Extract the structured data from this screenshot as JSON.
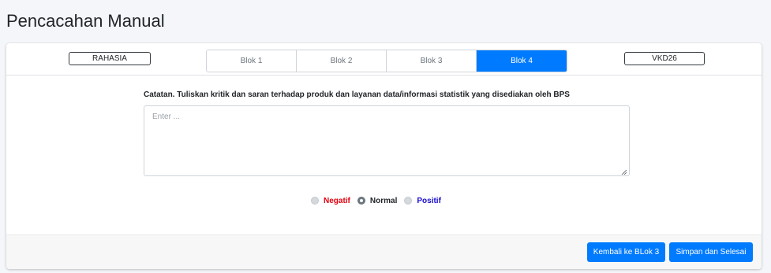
{
  "page": {
    "title": "Pencacahan Manual"
  },
  "header": {
    "left_badge": "RAHASIA",
    "right_badge": "VKD26",
    "tabs": [
      {
        "label": "Blok 1",
        "active": false
      },
      {
        "label": "Blok 2",
        "active": false
      },
      {
        "label": "Blok 3",
        "active": false
      },
      {
        "label": "Blok 4",
        "active": true
      }
    ]
  },
  "form": {
    "question": "Catatan. Tuliskan kritik dan saran terhadap produk dan layanan data/informasi statistik yang disediakan oleh BPS",
    "textarea": {
      "value": "",
      "placeholder": "Enter ..."
    },
    "sentiment": {
      "options": [
        {
          "label": "Negatif",
          "color": "#e3000f",
          "checked": false
        },
        {
          "label": "Normal",
          "color": "#212529",
          "checked": true
        },
        {
          "label": "Positif",
          "color": "#1a0dcc",
          "checked": false
        }
      ]
    }
  },
  "footer": {
    "back_label": "Kembali ke BLok 3",
    "save_label": "Simpan dan Selesai",
    "accent_color": "#007bff"
  }
}
